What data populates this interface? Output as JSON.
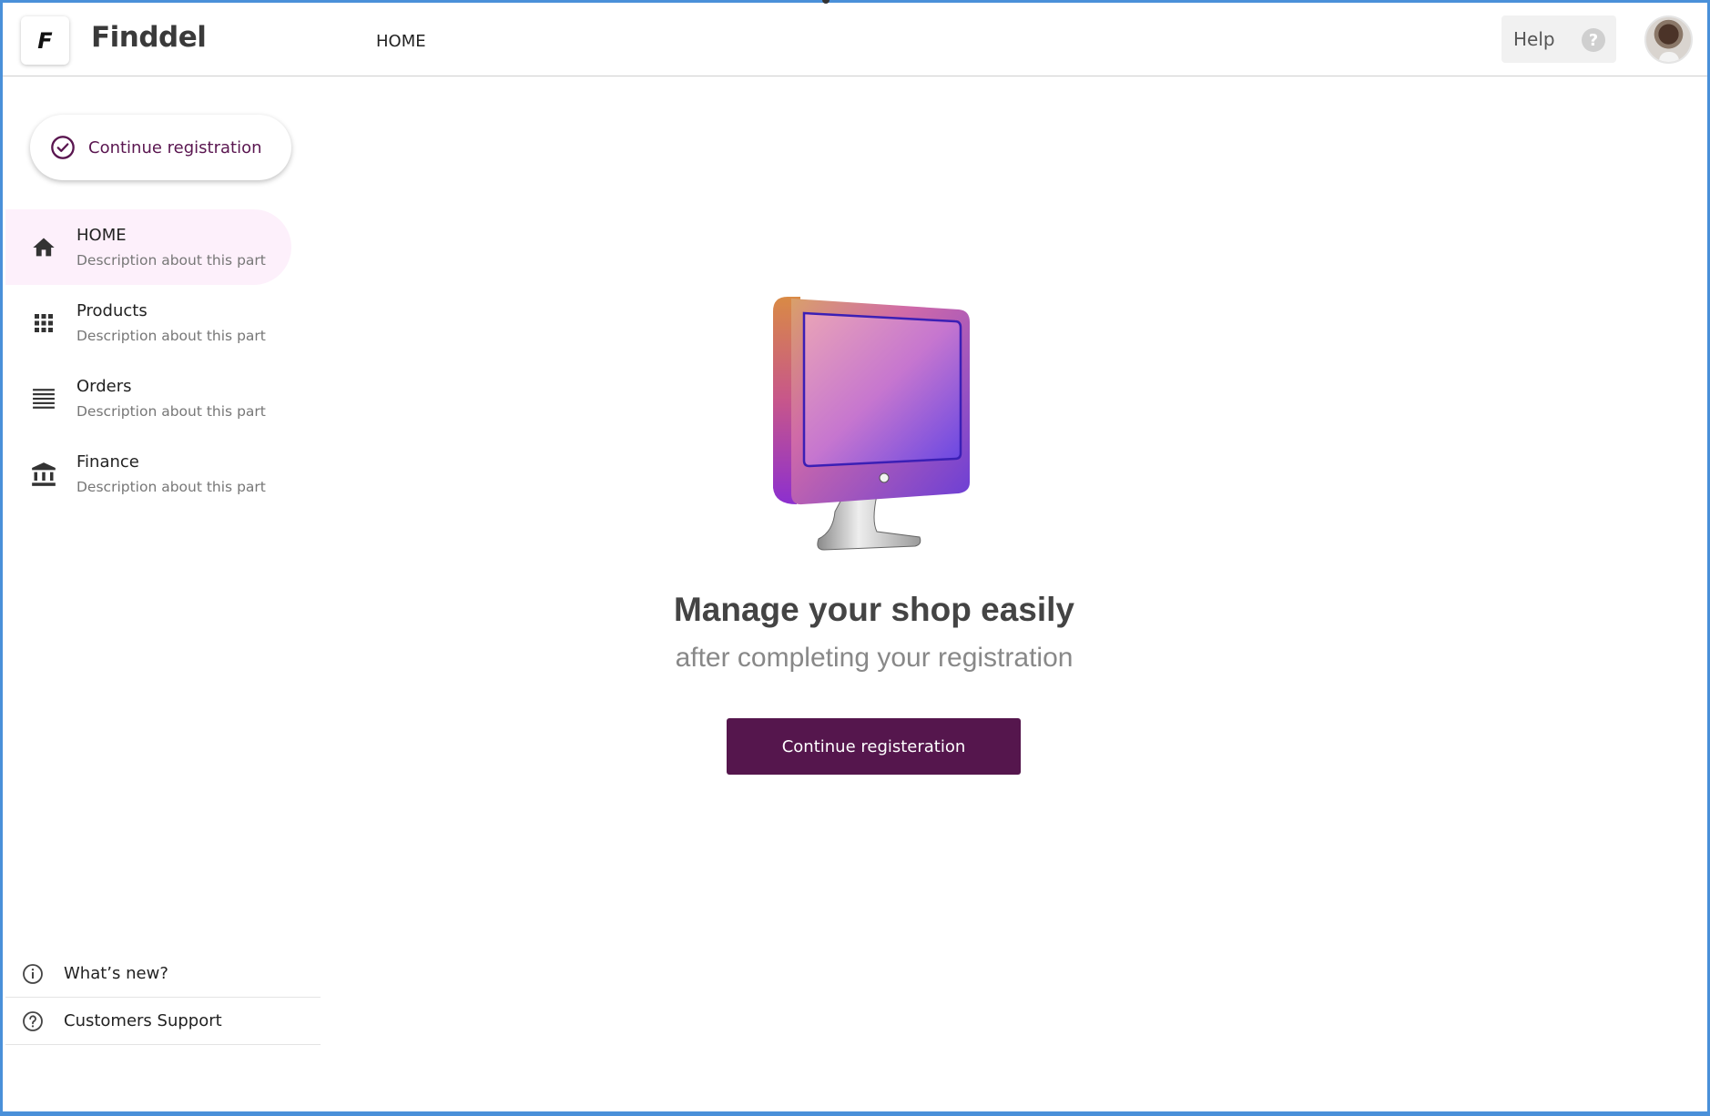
{
  "header": {
    "logo_letter": "F",
    "brand": "Finddel",
    "nav_label": "HOME",
    "help_label": "Help",
    "help_icon_glyph": "?"
  },
  "sidebar": {
    "cta_label": "Continue registration",
    "items": [
      {
        "label": "HOME",
        "description": "Description about this part",
        "icon": "home-icon",
        "active": true
      },
      {
        "label": "Products",
        "description": "Description about this part",
        "icon": "grid-icon",
        "active": false
      },
      {
        "label": "Orders",
        "description": "Description about this part",
        "icon": "list-icon",
        "active": false
      },
      {
        "label": "Finance",
        "description": "Description about this part",
        "icon": "bank-icon",
        "active": false
      }
    ],
    "footer_items": [
      {
        "label": "What’s new?",
        "icon": "info-icon"
      },
      {
        "label": "Customers Support",
        "icon": "help-circle-icon"
      }
    ]
  },
  "main": {
    "headline": "Manage your shop easily",
    "subline": "after completing your registration",
    "button_label": "Continue registeration"
  },
  "colors": {
    "brand_primary": "#55164d",
    "active_item_bg": "#fdf0fb",
    "window_border": "#4a90d9"
  }
}
